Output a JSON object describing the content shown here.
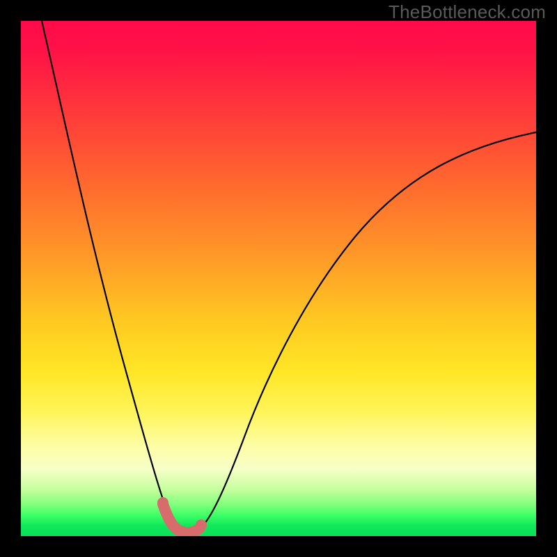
{
  "watermark": "TheBottleneck.com",
  "chart_data": {
    "type": "line",
    "title": "",
    "xlabel": "",
    "ylabel": "",
    "xlim": [
      0,
      1
    ],
    "ylim": [
      0,
      1
    ],
    "series": [
      {
        "name": "bottleneck-curve",
        "note": "approximate shape; vertical axis = bottleneck %, minimum near x≈0.30",
        "x": [
          0.0,
          0.05,
          0.1,
          0.15,
          0.2,
          0.22,
          0.24,
          0.26,
          0.28,
          0.3,
          0.32,
          0.34,
          0.36,
          0.4,
          0.5,
          0.6,
          0.7,
          0.8,
          0.9,
          1.0
        ],
        "y": [
          1.0,
          0.88,
          0.74,
          0.58,
          0.36,
          0.25,
          0.16,
          0.09,
          0.04,
          0.02,
          0.03,
          0.07,
          0.12,
          0.24,
          0.45,
          0.58,
          0.67,
          0.72,
          0.76,
          0.78
        ]
      }
    ],
    "background_gradient": {
      "top": "#ff0a4a",
      "mid": "#ffe626",
      "bottom": "#0be05a",
      "meaning": "red high bottleneck → green low bottleneck"
    },
    "marker_region": {
      "name": "optimal-range-marker",
      "color": "#d86b6b",
      "x_range": [
        0.27,
        0.35
      ],
      "trough_y": 0.02
    }
  }
}
